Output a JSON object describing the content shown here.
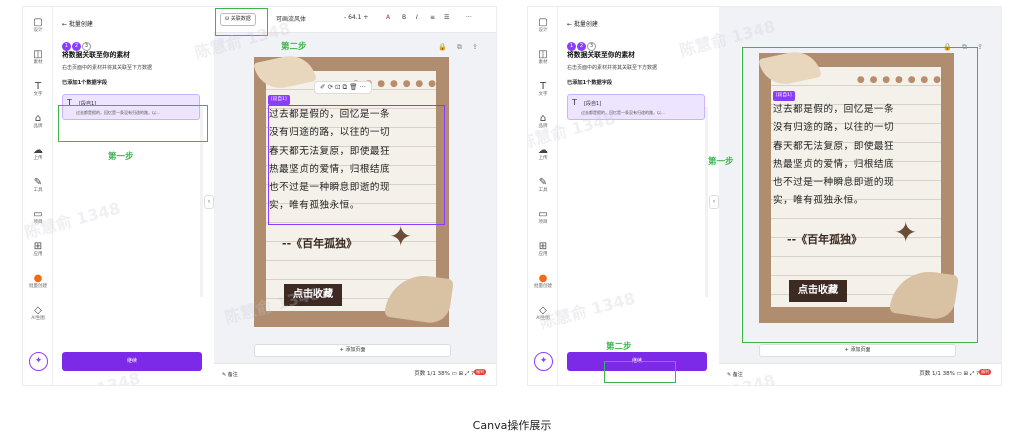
{
  "rail": [
    {
      "icon": "▢",
      "label": "设计",
      "name": "rail-design"
    },
    {
      "icon": "◫",
      "label": "素材",
      "name": "rail-elements"
    },
    {
      "icon": "T",
      "label": "文字",
      "name": "rail-text"
    },
    {
      "icon": "⌂",
      "label": "品牌",
      "name": "rail-brand"
    },
    {
      "icon": "☁",
      "label": "上传",
      "name": "rail-uploads"
    },
    {
      "icon": "✎",
      "label": "工具",
      "name": "rail-tools"
    },
    {
      "icon": "▭",
      "label": "项目",
      "name": "rail-projects"
    },
    {
      "icon": "⊞",
      "label": "应用",
      "name": "rail-apps"
    },
    {
      "icon": "●",
      "label": "批量创建",
      "name": "rail-bulk-create"
    },
    {
      "icon": "◇",
      "label": "AI生图",
      "name": "rail-ai-image"
    }
  ],
  "panel": {
    "back_label": "← 批量创建",
    "steps": [
      "1",
      "2",
      "3"
    ],
    "title": "将数据关联至你的素材",
    "desc": "右击页面中的素材并将其关联至下方数据",
    "field_section": "已添加1个数据字段",
    "field_name": "[段自1]",
    "field_desc": "过去都是假的，回忆是一条没有归途的路，以...",
    "generate_button": "继续"
  },
  "toolbar": {
    "connect_data": "关联数据",
    "font": "可画流风体",
    "font_size": "64.1",
    "more": "···"
  },
  "canvas": {
    "page_icons": "🔒 ⧉ ⇪",
    "data_tag": "[段自1]",
    "text_lines": [
      "过去都是假的，回忆是一条",
      "没有归途的路，以往的一切",
      "春天都无法复原，即使最狂",
      "热最坚贞的爱情，归根结底",
      "也不过是一种瞬息即逝的现",
      "实，唯有孤独永恒。"
    ],
    "ctx_icons": "✐ ⟳ ⊡ ⧉ 🗑 ···",
    "quote": "--《百年孤独》",
    "collect": "点击收藏",
    "dots": "● ● ● ● ● ● ●",
    "add_page": "+ 添加页面"
  },
  "bottom": {
    "notes": "备注",
    "page_info": "页数 1/1",
    "zoom": "38%",
    "badge": "福利"
  },
  "annotations": {
    "step1": "第一步",
    "step2": "第二步"
  },
  "watermark": "陈慧俞 1348",
  "caption": "Canva操作展示",
  "colors": {
    "accent": "#8b3dff",
    "highlight": "#3cb54a",
    "button": "#7d2ae8"
  }
}
